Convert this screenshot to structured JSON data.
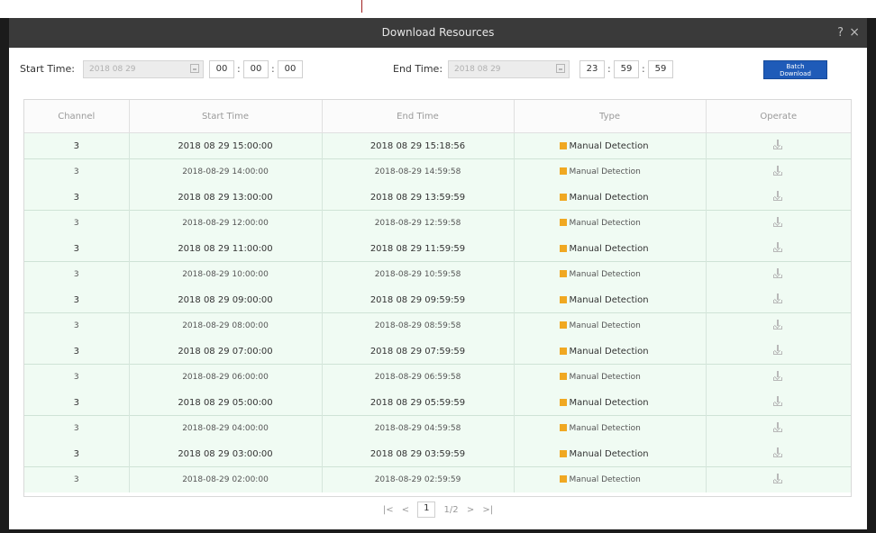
{
  "dialog": {
    "title": "Download Resources",
    "help_glyph": "?",
    "close_glyph": "×"
  },
  "filter": {
    "start_label": "Start Time:",
    "start_date": "2018 08 29",
    "start_hh": "00",
    "start_mm": "00",
    "start_ss": "00",
    "end_label": "End Time:",
    "end_date": "2018 08 29",
    "end_hh": "23",
    "end_mm": "59",
    "end_ss": "59",
    "time_sep": ":",
    "batch_line1": "Batch",
    "batch_line2": "Download"
  },
  "table": {
    "headers": {
      "channel": "Channel",
      "start": "Start Time",
      "end": "End Time",
      "type": "Type",
      "operate": "Operate"
    },
    "rows": [
      {
        "channel": "3",
        "start": "2018 08 29 15:00:00",
        "end": "2018 08 29 15:18:56",
        "type": "Manual Detection"
      },
      {
        "channel": "3",
        "start": "2018-08-29 14:00:00",
        "end": "2018-08-29 14:59:58",
        "type": "Manual Detection"
      },
      {
        "channel": "3",
        "start": "2018 08 29 13:00:00",
        "end": "2018 08 29 13:59:59",
        "type": "Manual Detection"
      },
      {
        "channel": "3",
        "start": "2018-08-29 12:00:00",
        "end": "2018-08-29 12:59:58",
        "type": "Manual Detection"
      },
      {
        "channel": "3",
        "start": "2018 08 29 11:00:00",
        "end": "2018 08 29 11:59:59",
        "type": "Manual Detection"
      },
      {
        "channel": "3",
        "start": "2018-08-29 10:00:00",
        "end": "2018-08-29 10:59:58",
        "type": "Manual Detection"
      },
      {
        "channel": "3",
        "start": "2018 08 29 09:00:00",
        "end": "2018 08 29 09:59:59",
        "type": "Manual Detection"
      },
      {
        "channel": "3",
        "start": "2018-08-29 08:00:00",
        "end": "2018-08-29 08:59:58",
        "type": "Manual Detection"
      },
      {
        "channel": "3",
        "start": "2018 08 29 07:00:00",
        "end": "2018 08 29 07:59:59",
        "type": "Manual Detection"
      },
      {
        "channel": "3",
        "start": "2018-08-29 06:00:00",
        "end": "2018-08-29 06:59:58",
        "type": "Manual Detection"
      },
      {
        "channel": "3",
        "start": "2018 08 29 05:00:00",
        "end": "2018 08 29 05:59:59",
        "type": "Manual Detection"
      },
      {
        "channel": "3",
        "start": "2018-08-29 04:00:00",
        "end": "2018-08-29 04:59:58",
        "type": "Manual Detection"
      },
      {
        "channel": "3",
        "start": "2018 08 29 03:00:00",
        "end": "2018 08 29 03:59:59",
        "type": "Manual Detection"
      },
      {
        "channel": "3",
        "start": "2018-08-29 02:00:00",
        "end": "2018-08-29 02:59:59",
        "type": "Manual Detection"
      }
    ],
    "type_color": "#f0a822"
  },
  "pager": {
    "first": "|<",
    "prev": "<",
    "current": "1",
    "total": "1/2",
    "next": ">",
    "last": ">|"
  }
}
